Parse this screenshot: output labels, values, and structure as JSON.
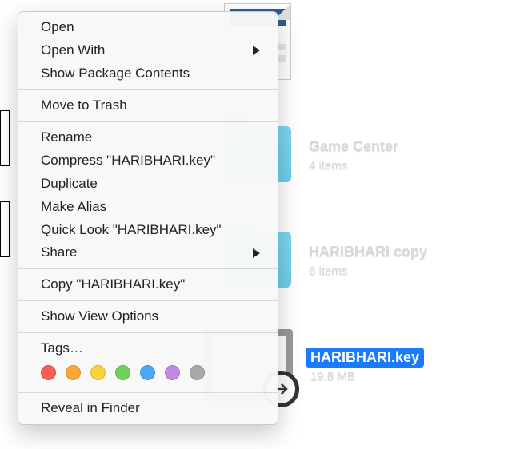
{
  "menu": {
    "items": [
      {
        "label": "Open",
        "submenu": false
      },
      {
        "label": "Open With",
        "submenu": true
      },
      {
        "label": "Show Package Contents",
        "submenu": false
      },
      "---",
      {
        "label": "Move to Trash",
        "submenu": false
      },
      "---",
      {
        "label": "Rename",
        "submenu": false
      },
      {
        "label": "Compress \"HARIBHARI.key\"",
        "submenu": false
      },
      {
        "label": "Duplicate",
        "submenu": false
      },
      {
        "label": "Make Alias",
        "submenu": false
      },
      {
        "label": "Quick Look \"HARIBHARI.key\"",
        "submenu": false
      },
      {
        "label": "Share",
        "submenu": true
      },
      "---",
      {
        "label": "Copy \"HARIBHARI.key\"",
        "submenu": false
      },
      "---",
      {
        "label": "Show View Options",
        "submenu": false
      },
      "---",
      {
        "label": "Tags…",
        "submenu": false
      }
    ],
    "reveal": "Reveal in Finder",
    "tag_colors": [
      "#f75f55",
      "#faa638",
      "#f9d33b",
      "#6fd25f",
      "#4aa8f6",
      "#c08ae3",
      "#a9a9a9"
    ]
  },
  "files": {
    "doc": {
      "name": "",
      "sub": ""
    },
    "game": {
      "name": "Game Center",
      "sub": "4 items"
    },
    "copy": {
      "name": "HARIBHARI copy",
      "sub": "6 items"
    },
    "key": {
      "name": "HARIBHARI.key",
      "sub": "19.8 MB"
    }
  }
}
